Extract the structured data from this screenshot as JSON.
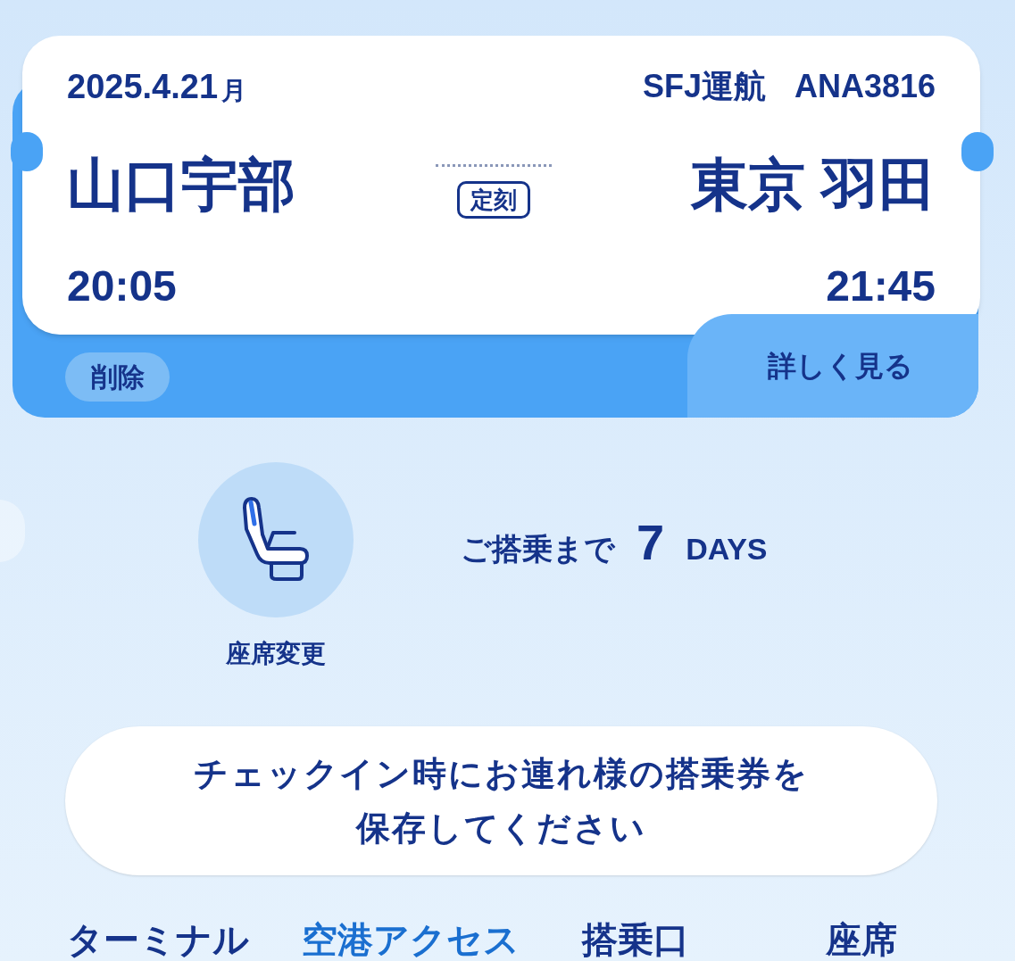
{
  "flight": {
    "date": "2025.4.21",
    "weekday": "月",
    "operator": "SFJ運航",
    "flight_number": "ANA3816",
    "origin": "山口宇部",
    "destination": "東京 羽田",
    "status": "定刻",
    "departure_time": "20:05",
    "arrival_time": "21:45"
  },
  "delete_button": "削除",
  "details_button": "詳しく見る",
  "seat_change": {
    "label": "座席変更"
  },
  "countdown": {
    "prefix": "ご搭乗まで",
    "number": "7",
    "unit": "DAYS"
  },
  "notice": "チェックイン時にお連れ様の搭乗券を保存してください",
  "tabs": [
    {
      "label": "ターミナル",
      "selected": false
    },
    {
      "label": "空港アクセス",
      "selected": true
    },
    {
      "label": "搭乗口",
      "selected": false
    },
    {
      "label": "座席",
      "selected": false
    }
  ]
}
